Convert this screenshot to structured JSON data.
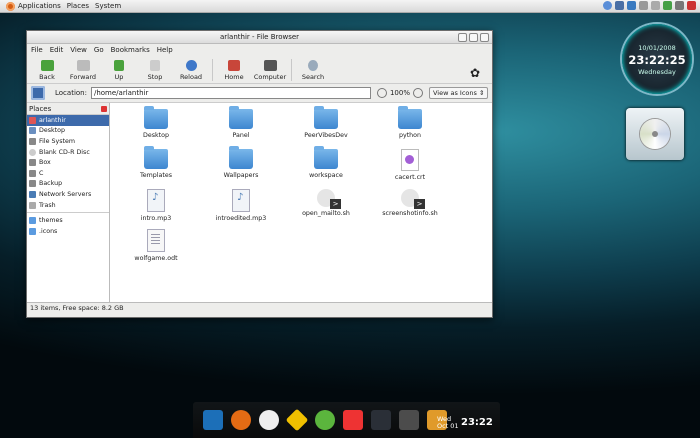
{
  "top_panel": {
    "menus": [
      "Applications",
      "Places",
      "System"
    ]
  },
  "clock_widget": {
    "date": "10/01/2008",
    "time": "23:22:25",
    "day": "Wednesday"
  },
  "window": {
    "title": "arlanthir - File Browser",
    "menubar": [
      "File",
      "Edit",
      "View",
      "Go",
      "Bookmarks",
      "Help"
    ],
    "toolbar": {
      "back": "Back",
      "forward": "Forward",
      "up": "Up",
      "stop": "Stop",
      "reload": "Reload",
      "home": "Home",
      "computer": "Computer",
      "search": "Search"
    },
    "location": {
      "label": "Location:",
      "value": "/home/arlanthir",
      "zoom": "100%",
      "view_mode": "View as Icons"
    },
    "sidebar": {
      "header": "Places",
      "items": [
        "arlanthir",
        "Desktop",
        "File System",
        "Blank CD-R Disc",
        "Box",
        "C",
        "Backup",
        "Network Servers",
        "Trash"
      ],
      "bookmarks": [
        "themes",
        ".icons"
      ]
    },
    "files": [
      {
        "name": "Desktop",
        "type": "folder"
      },
      {
        "name": "Panel",
        "type": "folder"
      },
      {
        "name": "PeerVibesDev",
        "type": "folder"
      },
      {
        "name": "python",
        "type": "folder"
      },
      {
        "name": "Templates",
        "type": "folder"
      },
      {
        "name": "Wallpapers",
        "type": "folder"
      },
      {
        "name": "workspace",
        "type": "folder"
      },
      {
        "name": "cacert.crt",
        "type": "cert"
      },
      {
        "name": "intro.mp3",
        "type": "mp3"
      },
      {
        "name": "introedited.mp3",
        "type": "mp3"
      },
      {
        "name": "open_mailto.sh",
        "type": "script"
      },
      {
        "name": "screenshotinfo.sh",
        "type": "script"
      },
      {
        "name": "wolfgame.odt",
        "type": "odt"
      }
    ],
    "status": "13 items, Free space: 8.2 GB"
  },
  "dock": {
    "date_day": "Wed",
    "date_month": "Oct 01",
    "time": "23:22"
  }
}
